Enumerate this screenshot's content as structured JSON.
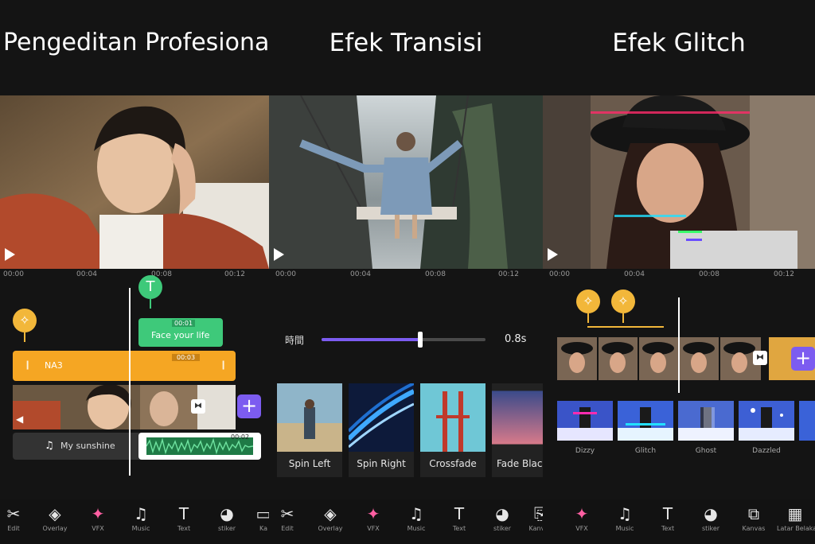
{
  "panels": [
    {
      "title": "Pengeditan Profesional",
      "ruler": [
        "00:00",
        "00:04",
        "00:08",
        "00:12"
      ],
      "text_pin": "T",
      "text_clip_label": "Face your life",
      "text_clip_time": "00:01",
      "audio_clip_label": "NA3",
      "audio_clip_time": "00:03",
      "music_label": "My sunshine",
      "music_time": "00:02",
      "add_label": "+",
      "tools": [
        {
          "icon": "scissors-icon",
          "glyph": "✂",
          "label": "Edit"
        },
        {
          "icon": "overlay-icon",
          "glyph": "◈",
          "label": "Overlay"
        },
        {
          "icon": "vfx-icon",
          "glyph": "✦",
          "label": "VFX"
        },
        {
          "icon": "music-icon",
          "glyph": "♫",
          "label": "Music"
        },
        {
          "icon": "text-icon",
          "glyph": "T",
          "label": "Text"
        },
        {
          "icon": "sticker-icon",
          "glyph": "◕",
          "label": "stiker"
        },
        {
          "icon": "canvas-icon",
          "glyph": "▭",
          "label": "Ka"
        }
      ]
    },
    {
      "title": "Efek Transisi",
      "ruler": [
        "00:00",
        "00:04",
        "00:08",
        "00:12"
      ],
      "duration_label": "時間",
      "duration_value": "0.8s",
      "duration_fraction": 0.6,
      "transitions": [
        "Spin Left",
        "Spin Right",
        "Crossfade",
        "Fade Blac"
      ],
      "tools": [
        {
          "icon": "scissors-icon",
          "glyph": "✂",
          "label": "Edit"
        },
        {
          "icon": "overlay-icon",
          "glyph": "◈",
          "label": "Overlay"
        },
        {
          "icon": "vfx-icon",
          "glyph": "✦",
          "label": "VFX"
        },
        {
          "icon": "music-icon",
          "glyph": "♫",
          "label": "Music"
        },
        {
          "icon": "text-icon",
          "glyph": "T",
          "label": "Text"
        },
        {
          "icon": "sticker-icon",
          "glyph": "◕",
          "label": "stiker"
        },
        {
          "icon": "canvas-icon",
          "glyph": "⎘",
          "label": "Kanvas"
        }
      ]
    },
    {
      "title": "Efek Glitch",
      "ruler": [
        "00:00",
        "00:04",
        "00:08",
        "00:12"
      ],
      "add_label": "+",
      "effects": [
        "Dizzy",
        "Glitch",
        "Ghost",
        "Dazzled"
      ],
      "tools": [
        {
          "icon": "vfx-icon",
          "glyph": "✦",
          "label": "VFX"
        },
        {
          "icon": "music-icon",
          "glyph": "♫",
          "label": "Music"
        },
        {
          "icon": "text-icon",
          "glyph": "T",
          "label": "Text"
        },
        {
          "icon": "sticker-icon",
          "glyph": "◕",
          "label": "stiker"
        },
        {
          "icon": "canvas-icon",
          "glyph": "⧉",
          "label": "Kanvas"
        },
        {
          "icon": "background-icon",
          "glyph": "▦",
          "label": "Latar Belakang"
        }
      ]
    }
  ],
  "colors": {
    "accent_purple": "#7c5cf0",
    "text_green": "#3ec97a",
    "audio_orange": "#f5a623",
    "sticker_yellow": "#f2b73a"
  }
}
